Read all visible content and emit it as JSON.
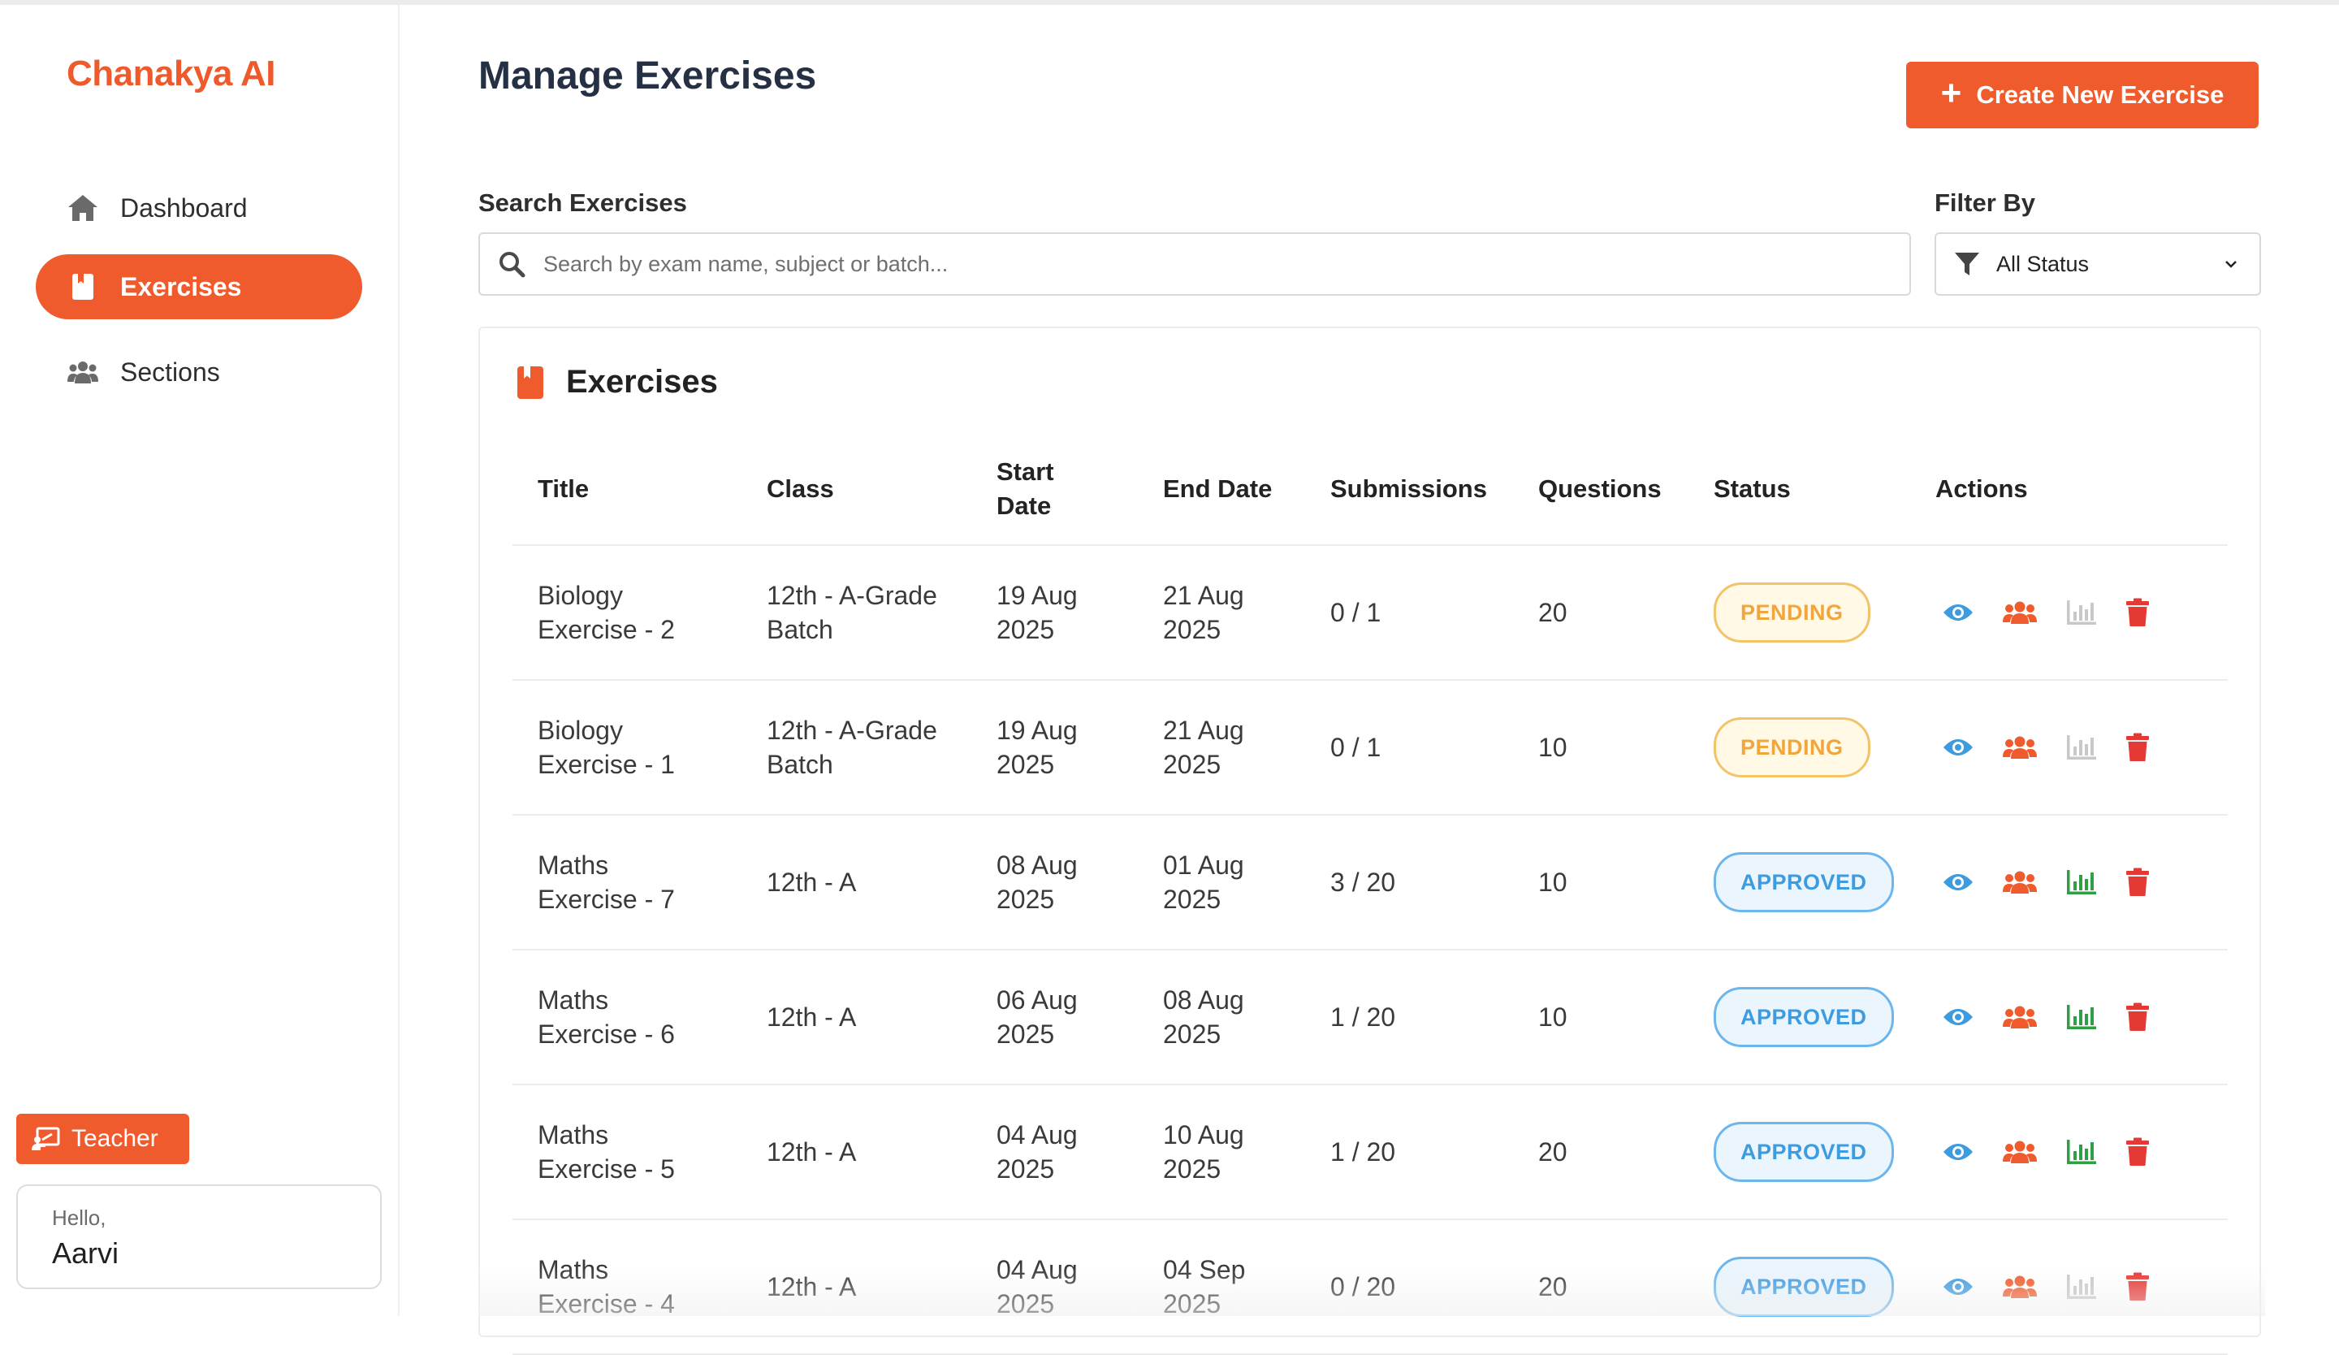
{
  "app": {
    "logo_text": "Chanakya AI",
    "accent_color": "#ef5b2c"
  },
  "sidebar": {
    "items": [
      {
        "label": "Dashboard",
        "icon": "home-icon",
        "active": false
      },
      {
        "label": "Exercises",
        "icon": "book-icon",
        "active": true
      },
      {
        "label": "Sections",
        "icon": "users-icon",
        "active": false
      }
    ],
    "role_badge": {
      "label": "Teacher",
      "icon": "teacher-icon"
    },
    "user": {
      "greeting": "Hello,",
      "name": "Aarvi"
    }
  },
  "header": {
    "title": "Manage Exercises",
    "create_button_label": "Create New Exercise"
  },
  "search": {
    "label": "Search Exercises",
    "placeholder": "Search by exam name, subject or batch...",
    "value": ""
  },
  "filter": {
    "label": "Filter By",
    "selected": "All Status"
  },
  "table": {
    "title": "Exercises",
    "columns": [
      "Title",
      "Class",
      "Start Date",
      "End Date",
      "Submissions",
      "Questions",
      "Status",
      "Actions"
    ],
    "rows": [
      {
        "title": "Biology Exercise - 2",
        "class": "12th - A-Grade Batch",
        "start": "19 Aug 2025",
        "end": "21 Aug 2025",
        "submissions": "0 / 1",
        "questions": "20",
        "status": "PENDING",
        "analytics_enabled": false
      },
      {
        "title": "Biology Exercise - 1",
        "class": "12th - A-Grade Batch",
        "start": "19 Aug 2025",
        "end": "21 Aug 2025",
        "submissions": "0 / 1",
        "questions": "10",
        "status": "PENDING",
        "analytics_enabled": false
      },
      {
        "title": "Maths Exercise - 7",
        "class": "12th - A",
        "start": "08 Aug 2025",
        "end": "01 Aug 2025",
        "submissions": "3 / 20",
        "questions": "10",
        "status": "APPROVED",
        "analytics_enabled": true
      },
      {
        "title": "Maths Exercise - 6",
        "class": "12th - A",
        "start": "06 Aug 2025",
        "end": "08 Aug 2025",
        "submissions": "1 / 20",
        "questions": "10",
        "status": "APPROVED",
        "analytics_enabled": true
      },
      {
        "title": "Maths Exercise - 5",
        "class": "12th - A",
        "start": "04 Aug 2025",
        "end": "10 Aug 2025",
        "submissions": "1 / 20",
        "questions": "20",
        "status": "APPROVED",
        "analytics_enabled": true
      },
      {
        "title": "Maths Exercise - 4",
        "class": "12th - A",
        "start": "04 Aug 2025",
        "end": "04 Sep 2025",
        "submissions": "0 / 20",
        "questions": "20",
        "status": "APPROVED",
        "analytics_enabled": false
      }
    ]
  },
  "colors": {
    "pending": "#f0a63c",
    "approved": "#3d9be0",
    "view_icon": "#3d9be0",
    "students_icon": "#ef5b2c",
    "analytics_enabled": "#2f9e44",
    "analytics_disabled": "#c8c8c8",
    "delete_icon": "#e53935"
  }
}
